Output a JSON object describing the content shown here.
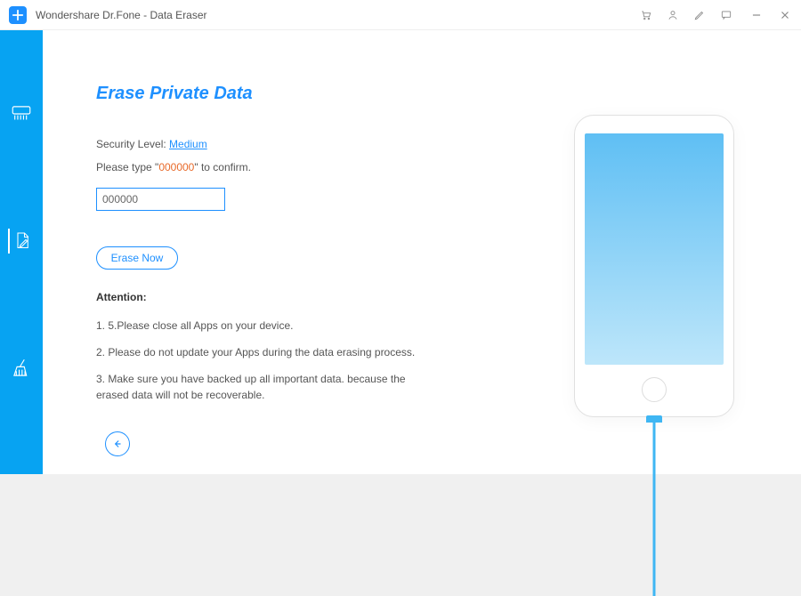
{
  "app": {
    "title": "Wondershare Dr.Fone - Data Eraser"
  },
  "titlebar_icons": {
    "cart": "cart-icon",
    "user": "user-icon",
    "edit": "edit-icon",
    "feedback": "feedback-icon"
  },
  "sidebar": {
    "items": [
      {
        "name": "shredder-icon"
      },
      {
        "name": "document-edit-icon"
      },
      {
        "name": "broom-icon"
      }
    ]
  },
  "main": {
    "heading": "Erase Private Data",
    "security_level_label": "Security Level:",
    "security_level_value": "Medium",
    "confirm_prompt_prefix": "Please type \"",
    "confirm_code": "000000",
    "confirm_prompt_suffix": "\" to confirm.",
    "confirm_input_value": "000000",
    "erase_button": "Erase Now",
    "attention_heading": "Attention:",
    "attention_items": [
      "1. 5.Please close all Apps on your device.",
      "2. Please do not update your Apps during the data erasing process.",
      "3. Make sure you have backed up all important data. because the erased data will not be recoverable."
    ]
  },
  "back_button": "back"
}
